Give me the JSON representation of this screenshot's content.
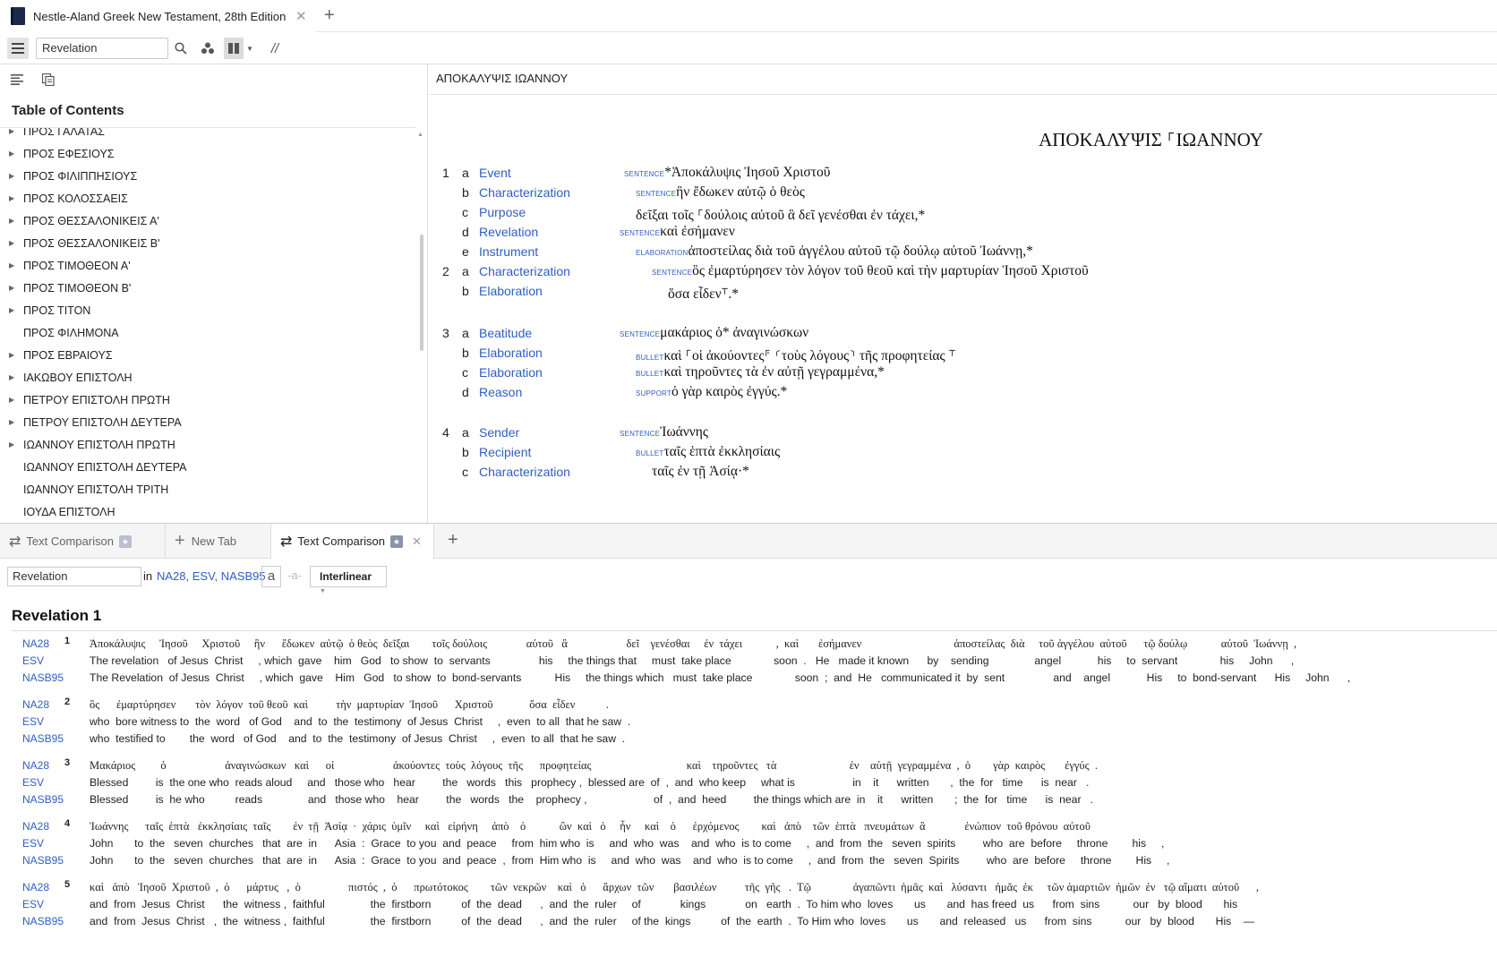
{
  "top_tab": {
    "title": "Nestle-Aland Greek New Testament, 28th Edition"
  },
  "toolbar": {
    "reference": "Revelation"
  },
  "toc": {
    "title": "Table of Contents",
    "items": [
      {
        "label": "ΠΡΟΣ ΓΑΛΑΤΑΣ",
        "arrow": true
      },
      {
        "label": "ΠΡΟΣ ΕΦΕΣΙΟΥΣ",
        "arrow": true
      },
      {
        "label": "ΠΡΟΣ ΦΙΛΙΠΠΗΣΙΟΥΣ",
        "arrow": true
      },
      {
        "label": "ΠΡΟΣ ΚΟΛΟΣΣΑΕΙΣ",
        "arrow": true
      },
      {
        "label": "ΠΡΟΣ ΘΕΣΣΑΛΟΝΙΚΕΙΣ Α'",
        "arrow": true
      },
      {
        "label": "ΠΡΟΣ ΘΕΣΣΑΛΟΝΙΚΕΙΣ Β'",
        "arrow": true
      },
      {
        "label": "ΠΡΟΣ ΤΙΜΟΘΕΟΝ Α'",
        "arrow": true
      },
      {
        "label": "ΠΡΟΣ ΤΙΜΟΘΕΟΝ Β'",
        "arrow": true
      },
      {
        "label": "ΠΡΟΣ ΤΙΤΟΝ",
        "arrow": true
      },
      {
        "label": "ΠΡΟΣ ΦΙΛΗΜΟΝΑ",
        "arrow": false
      },
      {
        "label": "ΠΡΟΣ ΕΒΡΑΙΟΥΣ",
        "arrow": true
      },
      {
        "label": "ΙΑΚΩΒΟΥ ΕΠΙΣΤΟΛΗ",
        "arrow": true
      },
      {
        "label": "ΠΕΤΡΟΥ ΕΠΙΣΤΟΛΗ ΠΡΩΤΗ",
        "arrow": true
      },
      {
        "label": "ΠΕΤΡΟΥ ΕΠΙΣΤΟΛΗ ΔΕΥΤΕΡΑ",
        "arrow": true
      },
      {
        "label": "ΙΩΑΝΝΟΥ ΕΠΙΣΤΟΛΗ ΠΡΩΤΗ",
        "arrow": true
      },
      {
        "label": "ΙΩΑΝΝΟΥ ΕΠΙΣΤΟΛΗ ΔΕΥΤΕΡΑ",
        "arrow": false
      },
      {
        "label": "ΙΩΑΝΝΟΥ ΕΠΙΣΤΟΛΗ ΤΡΙΤΗ",
        "arrow": false
      },
      {
        "label": "ΙΟΥΔΑ ΕΠΙΣΤΟΛΗ",
        "arrow": false
      }
    ]
  },
  "main": {
    "header": "ΑΠΟΚΑΛΥΨΙΣ ΙΩΑΝΝΟΥ",
    "title": "ΑΠΟΚΑΛΥΨΙΣ ⸀ΙΩΑΝΝΟΥ",
    "rows": [
      {
        "v": "1",
        "l": "a",
        "label": "Event",
        "tag": "Sentence",
        "text": "*Ἀποκάλυψις Ἰησοῦ Χριστοῦ"
      },
      {
        "v": "",
        "l": "b",
        "label": "Characterization",
        "tag": "Sentence",
        "text": "ἣν ἔδωκεν αὐτῷ ὁ θεὸς"
      },
      {
        "v": "",
        "l": "c",
        "label": "Purpose",
        "tag": "",
        "text": "δεῖξαι τοῖς ⸀δούλοις αὐτοῦ ἃ δεῖ γενέσθαι ἐν τάχει,*"
      },
      {
        "v": "",
        "l": "d",
        "label": "Revelation",
        "tag": "Sentence",
        "text": "καὶ ἐσήμανεν"
      },
      {
        "v": "",
        "l": "e",
        "label": "Instrument",
        "tag": "Elaboration",
        "text": "ἀποστείλας διὰ τοῦ ἀγγέλου αὐτοῦ τῷ δούλῳ αὐτοῦ Ἰωάννῃ,*"
      },
      {
        "v": "2",
        "l": "a",
        "label": "Characterization",
        "tag": "Sentence",
        "text": "ὃς ἐμαρτύρησεν τὸν λόγον τοῦ θεοῦ καὶ τὴν μαρτυρίαν Ἰησοῦ Χριστοῦ"
      },
      {
        "v": "",
        "l": "b",
        "label": "Elaboration",
        "tag": "",
        "text": "ὅσα εἶδεν⸆.*"
      },
      {
        "v": "3",
        "l": "a",
        "label": "Beatitude",
        "tag": "Sentence",
        "text": "μακάριος ὁ* ἀναγινώσκων"
      },
      {
        "v": "",
        "l": "b",
        "label": "Elaboration",
        "tag": "Bullet",
        "text": "καὶ ⸀οἱ ἀκούοντες⸁ ⸂τοὺς λόγους⸃ τῆς προφητείας ⸆"
      },
      {
        "v": "",
        "l": "c",
        "label": "Elaboration",
        "tag": "Bullet",
        "text": "καὶ τηροῦντες τὰ ἐν αὐτῇ γεγραμμένα,*"
      },
      {
        "v": "",
        "l": "d",
        "label": "Reason",
        "tag": "Support",
        "text": "ὁ γὰρ καιρὸς ἐγγύς.*"
      },
      {
        "v": "4",
        "l": "a",
        "label": "Sender",
        "tag": "Sentence",
        "text": "Ἰωάννης"
      },
      {
        "v": "",
        "l": "b",
        "label": "Recipient",
        "tag": "Bullet",
        "text": "ταῖς ἑπτὰ ἐκκλησίαις"
      },
      {
        "v": "",
        "l": "c",
        "label": "Characterization",
        "tag": "",
        "text": "ταῖς ἐν τῇ Ἀσίᾳ·*"
      }
    ]
  },
  "lower_tabs": [
    {
      "label": "Text Comparison"
    },
    {
      "label": "New Tab"
    },
    {
      "label": "Text Comparison"
    }
  ],
  "comparison": {
    "reference": "Revelation",
    "in_label": "in",
    "versions": "NA28, ESV, NASB95",
    "a_button": "a",
    "a_button2": "-a-",
    "mode": "Interlinear",
    "title": "Revelation 1",
    "verses": [
      {
        "num": "1",
        "lines": [
          {
            "ver": "NA28",
            "text": "Ἀποκάλυψις     Ἰησοῦ     Χριστοῦ     ἣν      ἔδωκεν  αὐτῷ  ὁ θεὸς  δεῖξαι        τοῖς δούλοις              αὐτοῦ   ἃ                     δεῖ    γενέσθαι     ἐν  τάχει            ,  καὶ       ἐσήμανεν                                 ἀποστείλας  διὰ     τοῦ ἀγγέλου  αὐτοῦ      τῷ δούλῳ            αὐτοῦ  Ἰωάννῃ  ,"
          },
          {
            "ver": "ESV",
            "text": "The revelation   of Jesus  Christ     , which  gave    him   God   to show  to  servants                his     the things that     must  take place              soon  .   He   made it known      by    sending               angel            his     to  servant              his     John      ,"
          },
          {
            "ver": "NASB95",
            "text": "The Revelation  of Jesus  Christ     , which  gave    Him   God   to show  to  bond-servants           His     the things which   must  take place              soon  ;  and  He   communicated it  by  sent                and    angel            His     to  bond-servant      His     John      ,"
          }
        ]
      },
      {
        "num": "2",
        "lines": [
          {
            "ver": "NA28",
            "text": "ὃς      ἐμαρτύρησεν       τὸν  λόγον  τοῦ θεοῦ  καὶ          τὴν  μαρτυρίαν  Ἰησοῦ      Χριστοῦ             ὅσα  εἶδεν           ."
          },
          {
            "ver": "ESV",
            "text": "who  bore witness to  the  word   of God    and  to  the  testimony  of Jesus  Christ     ,  even  to all  that he saw  ."
          },
          {
            "ver": "NASB95",
            "text": "who  testified to        the  word   of God    and  to  the  testimony  of Jesus  Christ     ,  even  to all  that he saw  ."
          }
        ]
      },
      {
        "num": "3",
        "lines": [
          {
            "ver": "NA28",
            "text": "Μακάριος         ὁ                     ἀναγινώσκων   καὶ      οἱ                     ἀκούοντες  τοὺς  λόγους  τῆς      προφητείας                                  καὶ    τηροῦντες   τὰ                          ἐν    αὐτῇ  γεγραμμένα  ,  ὁ        γὰρ  καιρὸς       ἐγγύς  ."
          },
          {
            "ver": "ESV",
            "text": "Blessed         is  the one who  reads aloud     and   those who   hear         the   words   this   prophecy ,  blessed are  of  ,  and  who keep     what is                   in    it      written       ,  the  for   time      is  near   ."
          },
          {
            "ver": "NASB95",
            "text": "Blessed         is  he who          reads               and   those who    hear         the   words   the    prophecy ,                      of  ,  and  heed         the things which are  in    it      written       ;  the  for   time      is  near   ."
          }
        ]
      },
      {
        "num": "4",
        "lines": [
          {
            "ver": "NA28",
            "text": "Ἰωάννης      ταῖς  ἑπτὰ   ἐκκλησίαις  ταῖς        ἐν  τῇ  Ἀσίᾳ  ·  χάρις  ὑμῖν     καὶ   εἰρήνη     ἀπὸ    ὁ            ὢν  καὶ   ὁ     ἦν     καὶ    ὁ      ἐρχόμενος        καὶ   ἀπὸ    τῶν  ἑπτὰ   πνευμάτων  ἃ              ἐνώπιον  τοῦ θρόνου  αὐτοῦ"
          },
          {
            "ver": "ESV",
            "text": "John       to  the   seven  churches   that  are  in      Asia  :  Grace  to you  and  peace     from  him who  is     and  who  was    and  who  is to come     ,  and  from  the   seven  spirits         who  are  before     throne        his     ,"
          },
          {
            "ver": "NASB95",
            "text": "John       to  the   seven  churches   that  are  in      Asia  :  Grace  to you  and  peace  ,  from  Him who  is     and  who  was    and  who  is to come     ,  and  from  the   seven  Spirits         who  are  before     throne        His     ,"
          }
        ]
      },
      {
        "num": "5",
        "lines": [
          {
            "ver": "NA28",
            "text": "καὶ   ἀπὸ   Ἰησοῦ  Χριστοῦ  ,  ὁ      μάρτυς   ,  ὁ                 πιστός  ,  ὁ      πρωτότοκος        τῶν  νεκρῶν    καὶ   ὁ      ἄρχων  τῶν       βασιλέων          τῆς  γῆς   .  Τῷ               ἀγαπῶντι  ἡμᾶς  καὶ   λύσαντι   ἡμᾶς  ἐκ     τῶν ἁμαρτιῶν  ἡμῶν  ἐν   τῷ αἵματι  αὐτοῦ      ,"
          },
          {
            "ver": "ESV",
            "text": "and  from  Jesus  Christ      the  witness ,  faithful               the  firstborn          of  the  dead      ,  and  the  ruler     of             kings             on   earth  .  To him who  loves       us       and  has freed  us      from  sins           our   by  blood       his"
          },
          {
            "ver": "NASB95",
            "text": "and  from  Jesus  Christ   ,  the  witness ,  faithful               the  firstborn          of  the  dead      ,  and  the  ruler     of the  kings          of  the  earth  .  To Him who  loves       us       and  released   us      from  sins           our   by  blood       His    —"
          }
        ]
      }
    ]
  },
  "colors": {
    "link": "#2f5ec4",
    "tag": "#2f5ec4",
    "accent": "#1c2a4a"
  }
}
